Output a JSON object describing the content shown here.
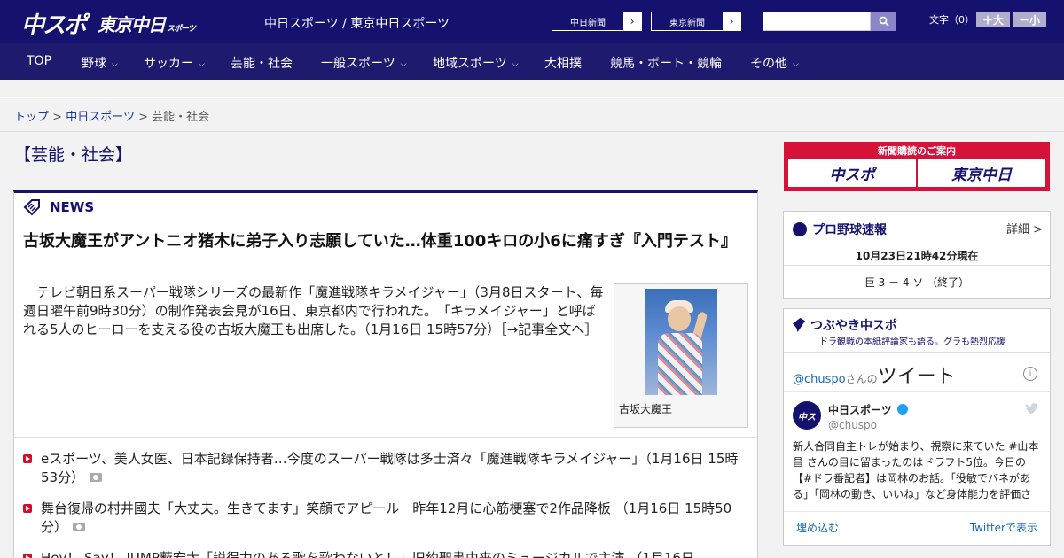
{
  "header": {
    "logo_chuspo": "中スポ",
    "logo_tokyo": "東京中日",
    "logo_tokyo_sub": "スポーツ",
    "site_link": "中日スポーツ / 東京中日スポーツ",
    "paper_buttons": [
      {
        "label": "中日新聞",
        "arrow": "›"
      },
      {
        "label": "東京新聞",
        "arrow": "›"
      }
    ],
    "search": {
      "placeholder": "",
      "icon": "search-icon"
    },
    "font_size": {
      "label": "文字（0）",
      "bigger": "＋大",
      "smaller": "－小"
    }
  },
  "nav": {
    "items": [
      {
        "label": "TOP",
        "dropdown": false
      },
      {
        "label": "野球",
        "dropdown": true
      },
      {
        "label": "サッカー",
        "dropdown": true
      },
      {
        "label": "芸能・社会",
        "dropdown": false
      },
      {
        "label": "一般スポーツ",
        "dropdown": true
      },
      {
        "label": "地域スポーツ",
        "dropdown": true
      },
      {
        "label": "大相撲",
        "dropdown": false
      },
      {
        "label": "競馬・ボート・競輪",
        "dropdown": false
      },
      {
        "label": "その他",
        "dropdown": true
      }
    ],
    "chevron": "⌵"
  },
  "breadcrumb": {
    "top": "トップ",
    "sep": ">",
    "chunichi": "中日スポーツ",
    "current": "芸能・社会"
  },
  "section_title": "【芸能・社会】",
  "news": {
    "label": "NEWS",
    "headline": "古坂大魔王がアントニオ猪木に弟子入り志願していた…体重100キロの小6に痛すぎ『入門テスト』",
    "lead": "　テレビ朝日系スーパー戦隊シリーズの最新作「魔進戦隊キラメイジャー」（3月8日スタート、毎週日曜午前9時30分）の制作発表会見が16日、東京都内で行われた。　「キラメイジャー」と呼ばれる5人のヒーローを支える役の古坂大魔王も出席した。（1月16日 15時57分）［→記事全文へ］",
    "photo_caption": "古坂大魔王",
    "items": [
      {
        "text": "eスポーツ、美人女医、日本記録保持者…今度のスーパー戦隊は多士済々「魔進戦隊キラメイジャー」（1月16日 15時53分）"
      },
      {
        "text": "舞台復帰の村井國夫「大丈夫。生きてます」笑顔でアピール　昨年12月に心筋梗塞で2作品降板 （1月16日 15時50分）"
      },
      {
        "text": "Hey！ Say！ JUMP薮宏太「説得力のある歌を歌わないと！」旧約聖書由来のミュージカルで主演 （1月16日"
      }
    ]
  },
  "sidebar": {
    "ad": {
      "title": "新聞購読のご案内",
      "logo1": "中スポ",
      "logo2": "東京中日"
    },
    "baseball": {
      "title": "プロ野球速報",
      "detail": "詳細 >",
      "timestamp": "10月23日21時42分現在",
      "score": "巨 3 － 4 ソ （終了）"
    },
    "twitter": {
      "title": "つぶやき中スポ",
      "subtitle": "ドラ観戦の本紙評論家も語る。グラも熱烈応援",
      "handle_line": "@chuspo",
      "handle_suffix": "さんの",
      "tweets_label": "ツイート",
      "account_name": "中日スポーツ",
      "account_handle": "@chuspo",
      "tweet_text": "新人合同自主トレが始まり、視察に来ていた #山本昌 さんの目に留まったのはドラフト5位。今日の【#ドラ番記者】は岡林のお話。「役敏でバネがある」「岡林の動き、いいね」など身体能力を評価さ",
      "embed": "埋め込む",
      "view_on_twitter": "Twitterで表示"
    }
  }
}
